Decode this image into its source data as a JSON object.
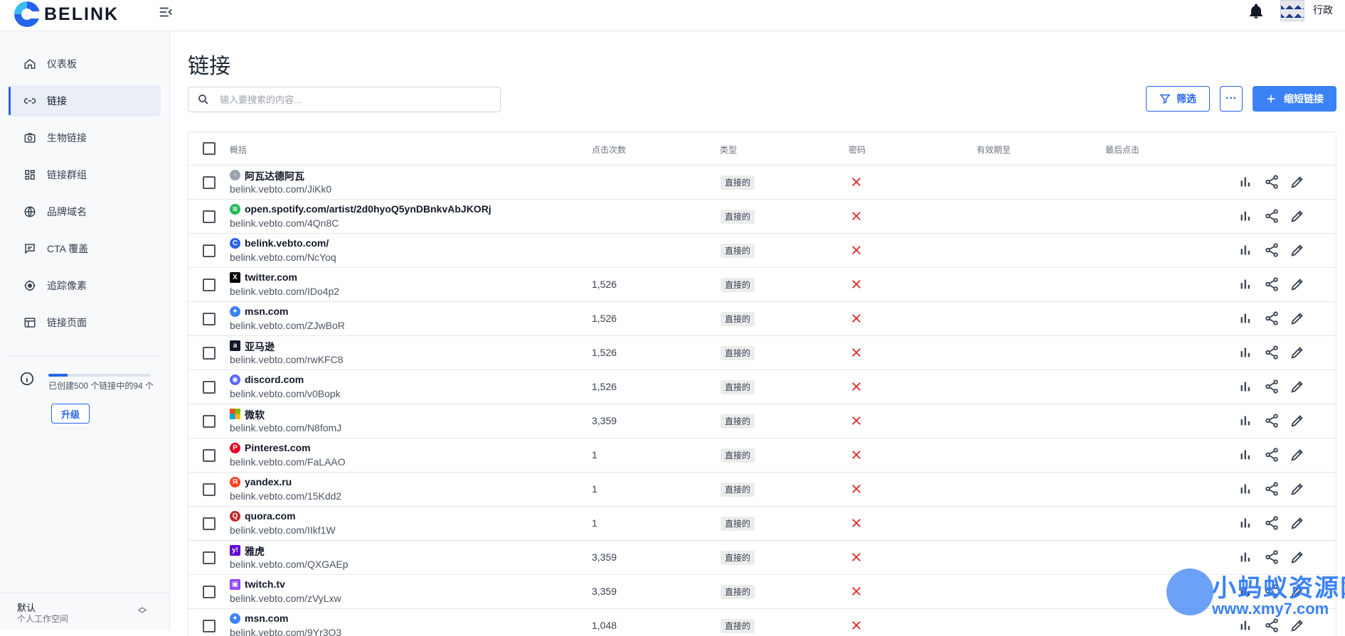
{
  "app": {
    "brand": "BELINK",
    "user_name": "行政"
  },
  "sidebar": {
    "items": [
      {
        "label": "仪表板",
        "icon": "home-icon"
      },
      {
        "label": "链接",
        "icon": "link-icon",
        "active": true
      },
      {
        "label": "生物链接",
        "icon": "camera-icon"
      },
      {
        "label": "链接群组",
        "icon": "grid-icon"
      },
      {
        "label": "品牌域名",
        "icon": "globe-icon"
      },
      {
        "label": "CTA 覆盖",
        "icon": "message-icon"
      },
      {
        "label": "追踪像素",
        "icon": "target-icon"
      },
      {
        "label": "链接页面",
        "icon": "layout-icon"
      }
    ],
    "usage": {
      "text": "已创建500 个链接中的94 个",
      "fraction": 0.188
    },
    "upgrade_label": "升级",
    "workspace": {
      "name": "默认",
      "subtitle": "个人工作空间"
    }
  },
  "main": {
    "title": "链接",
    "search_placeholder": "输入要搜索的内容...",
    "filter_label": "筛选",
    "more_label": "···",
    "new_label": "缩短链接"
  },
  "table": {
    "headers": {
      "summary": "概括",
      "clicks": "点击次数",
      "type": "类型",
      "password": "密码",
      "expires": "有效期至",
      "last_click": "最后点击"
    },
    "rows": [
      {
        "title": "阿瓦达德阿瓦",
        "short": "belink.vebto.com/JiKk0",
        "clicks": "",
        "type": "直接的",
        "fav": "generic",
        "color": "#9ca3af"
      },
      {
        "title": "open.spotify.com/artist/2d0hyoQ5ynDBnkvAbJKORj",
        "short": "belink.vebto.com/4Qn8C",
        "clicks": "",
        "type": "直接的",
        "fav": "spotify",
        "color": "#1db954"
      },
      {
        "title": "belink.vebto.com/",
        "short": "belink.vebto.com/NcYoq",
        "clicks": "",
        "type": "直接的",
        "fav": "belink",
        "color": "#2563eb"
      },
      {
        "title": "twitter.com",
        "short": "belink.vebto.com/IDo4p2",
        "clicks": "1,526",
        "type": "直接的",
        "fav": "x",
        "color": "#000000"
      },
      {
        "title": "msn.com",
        "short": "belink.vebto.com/ZJwBoR",
        "clicks": "1,526",
        "type": "直接的",
        "fav": "msn",
        "color": "#3b82f6"
      },
      {
        "title": "亚马逊",
        "short": "belink.vebto.com/rwKFC8",
        "clicks": "1,526",
        "type": "直接的",
        "fav": "amazon",
        "color": "#111827"
      },
      {
        "title": "discord.com",
        "short": "belink.vebto.com/v0Bopk",
        "clicks": "1,526",
        "type": "直接的",
        "fav": "discord",
        "color": "#5865f2"
      },
      {
        "title": "微软",
        "short": "belink.vebto.com/N8fomJ",
        "clicks": "3,359",
        "type": "直接的",
        "fav": "microsoft",
        "color": "#f25022"
      },
      {
        "title": "Pinterest.com",
        "short": "belink.vebto.com/FaLAAO",
        "clicks": "1",
        "type": "直接的",
        "fav": "pinterest",
        "color": "#e60023"
      },
      {
        "title": "yandex.ru",
        "short": "belink.vebto.com/15Kdd2",
        "clicks": "1",
        "type": "直接的",
        "fav": "yandex",
        "color": "#fc3f1d"
      },
      {
        "title": "quora.com",
        "short": "belink.vebto.com/IIkf1W",
        "clicks": "1",
        "type": "直接的",
        "fav": "quora",
        "color": "#b92b27"
      },
      {
        "title": "雅虎",
        "short": "belink.vebto.com/QXGAEp",
        "clicks": "3,359",
        "type": "直接的",
        "fav": "yahoo",
        "color": "#6001d2"
      },
      {
        "title": "twitch.tv",
        "short": "belink.vebto.com/zVyLxw",
        "clicks": "3,359",
        "type": "直接的",
        "fav": "twitch",
        "color": "#9146ff"
      },
      {
        "title": "msn.com",
        "short": "belink.vebto.com/9Yr3O3",
        "clicks": "1,048",
        "type": "直接的",
        "fav": "msn",
        "color": "#3b82f6"
      }
    ]
  },
  "watermark": {
    "text": "小蚂蚁资源网",
    "url": "www.xmy7.com"
  },
  "colors": {
    "accent": "#3b82f6",
    "danger": "#dc2626",
    "sidebar_bg": "#f8f9fb"
  }
}
